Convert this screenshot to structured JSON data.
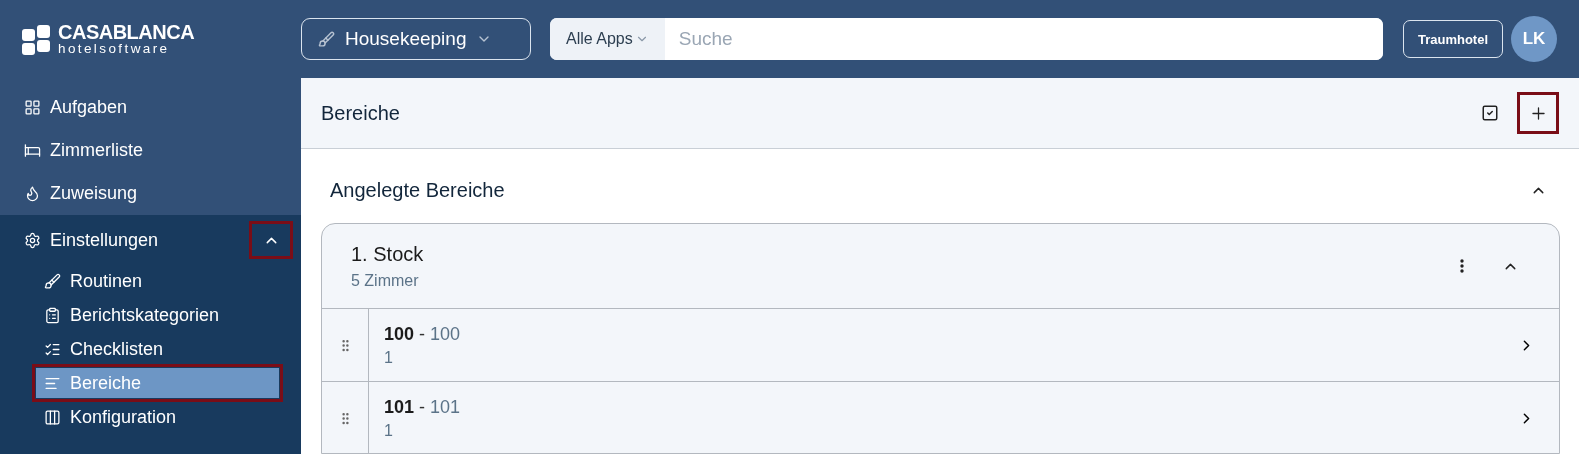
{
  "logo": {
    "name": "CASABLANCA",
    "tagline": "hotelsoftware"
  },
  "app_switcher": {
    "label": "Housekeeping"
  },
  "search": {
    "scope": "Alle Apps",
    "placeholder": "Suche"
  },
  "hotel_button": {
    "label": "Traumhotel"
  },
  "avatar": {
    "initials": "LK"
  },
  "sidebar": {
    "items": [
      {
        "label": "Aufgaben",
        "selected": false
      },
      {
        "label": "Zimmerliste",
        "selected": false
      },
      {
        "label": "Zuweisung",
        "selected": false
      },
      {
        "label": "Einstellungen",
        "selected": false,
        "expanded": true,
        "highlighted": true,
        "children": [
          {
            "label": "Routinen",
            "selected": false
          },
          {
            "label": "Berichtskategorien",
            "selected": false
          },
          {
            "label": "Checklisten",
            "selected": false
          },
          {
            "label": "Bereiche",
            "selected": true
          },
          {
            "label": "Konfiguration",
            "selected": false
          }
        ]
      }
    ]
  },
  "page": {
    "title": "Bereiche",
    "add_highlighted": true
  },
  "section": {
    "title": "Angelegte Bereiche",
    "expanded": true,
    "groups": [
      {
        "title": "1. Stock",
        "subtitle": "5 Zimmer",
        "expanded": true,
        "rooms": [
          {
            "number": "100",
            "separator": "-",
            "name": "100",
            "sub": "1"
          },
          {
            "number": "101",
            "separator": "-",
            "name": "101",
            "sub": "1"
          }
        ]
      }
    ]
  }
}
